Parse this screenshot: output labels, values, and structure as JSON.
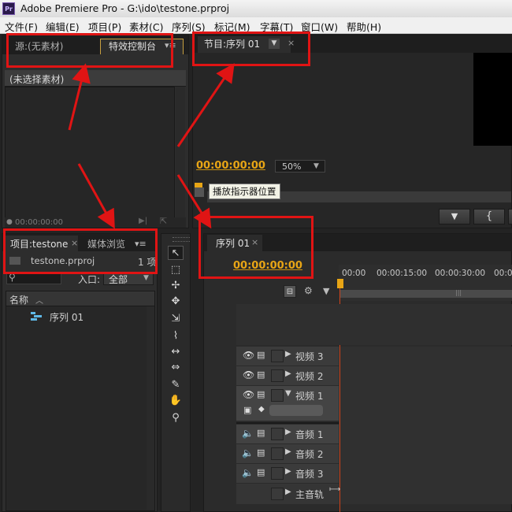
{
  "window": {
    "app_icon": "Pr",
    "title": "Adobe Premiere Pro - G:\\ido\\testone.prproj"
  },
  "menu": [
    "文件(F)",
    "编辑(E)",
    "项目(P)",
    "素材(C)",
    "序列(S)",
    "标记(M)",
    "字幕(T)",
    "窗口(W)",
    "帮助(H)"
  ],
  "source_panel": {
    "tab_source": "源:(无素材)",
    "tab_effect_controls": "特效控制台",
    "no_clip_selected": "(未选择素材)",
    "timecode": "00:00:00:00"
  },
  "program_monitor": {
    "tab": "节目:序列 01",
    "timecode": "00:00:00:00",
    "zoom": "50%",
    "tooltip": "播放指示器位置"
  },
  "project_panel": {
    "tab_project": "项目:testone",
    "tab_media_browser": "媒体浏览",
    "project_file": "testone.prproj",
    "item_count": "1 项",
    "entry_label": "入口:",
    "entry_value": "全部",
    "col_name": "名称",
    "items": [
      "序列 01"
    ]
  },
  "timeline": {
    "tab": "序列 01",
    "timecode": "00:00:00:00",
    "ruler": [
      "00:00",
      "00:00:15:00",
      "00:00:30:00",
      "00:0"
    ],
    "video_tracks": [
      "视频 3",
      "视频 2",
      "视频 1"
    ],
    "audio_tracks": [
      "音频 1",
      "音频 2",
      "音频 3"
    ],
    "master_track": "主音轨"
  },
  "colors": {
    "timecode": "#e8a515",
    "annotation": "#e01414",
    "playhead": "#d0431a"
  }
}
